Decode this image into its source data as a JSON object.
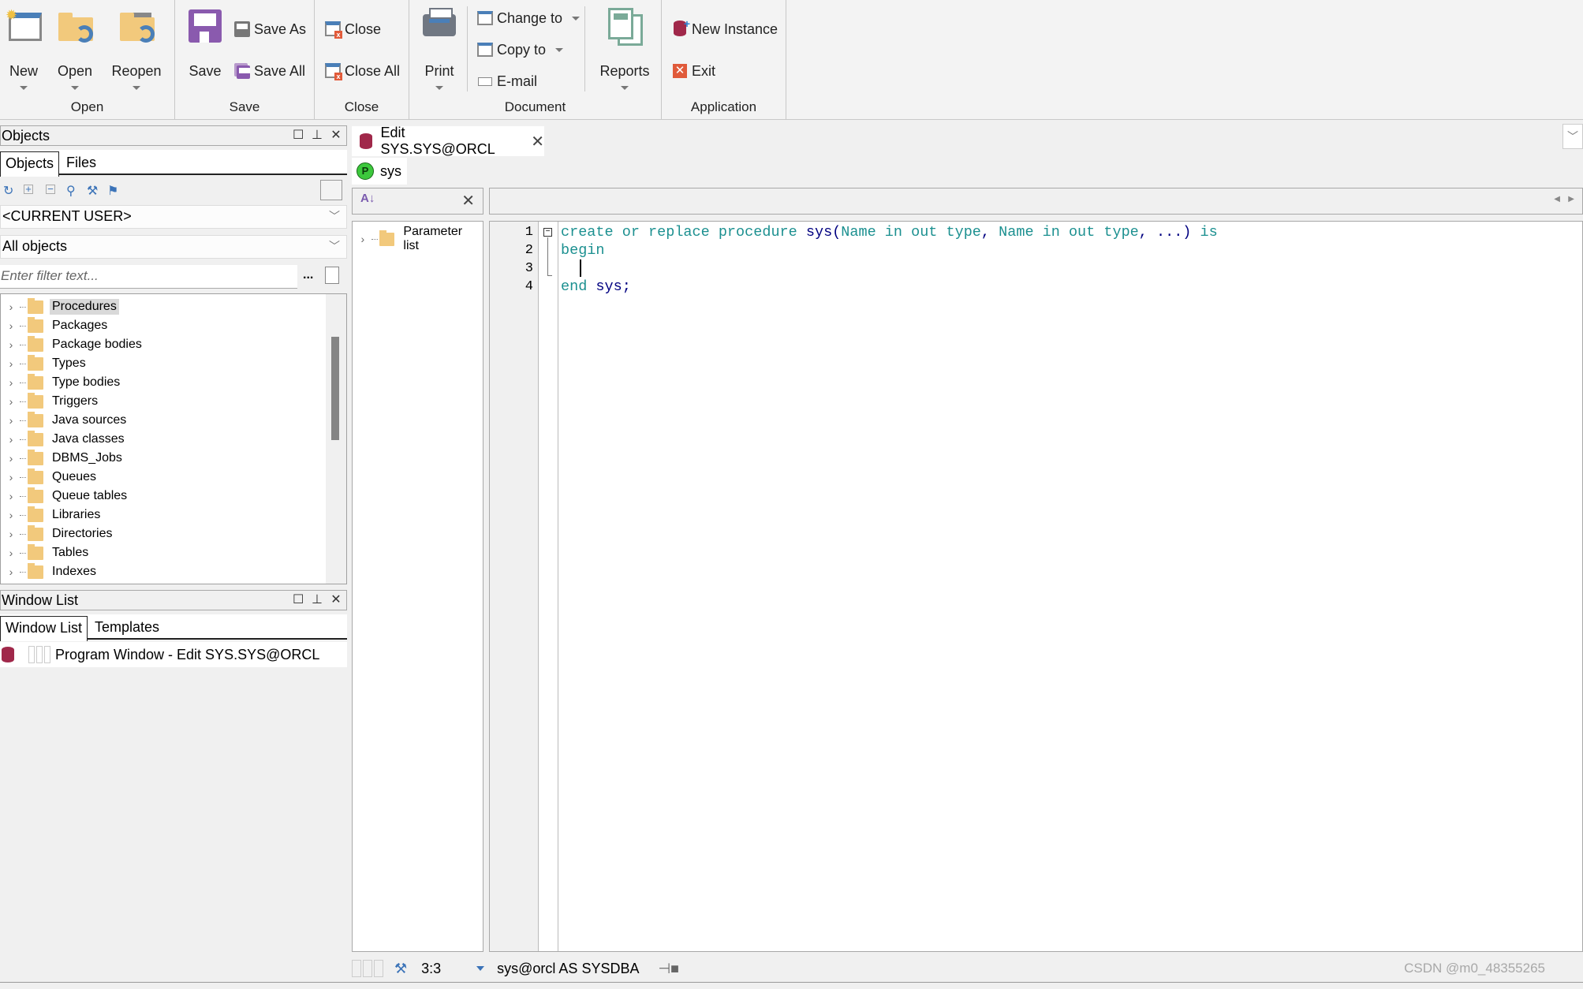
{
  "ribbon": {
    "groups": {
      "open": {
        "label": "Open",
        "new": "New",
        "open": "Open",
        "reopen": "Reopen"
      },
      "save": {
        "label": "Save",
        "save": "Save",
        "save_as": "Save As",
        "save_all": "Save All"
      },
      "close": {
        "label": "Close",
        "close": "Close",
        "close_all": "Close All"
      },
      "document": {
        "label": "Document",
        "print": "Print",
        "change_to": "Change to",
        "copy_to": "Copy to",
        "email": "E-mail",
        "reports": "Reports"
      },
      "application": {
        "label": "Application",
        "new_instance": "New Instance",
        "exit": "Exit"
      }
    }
  },
  "objects_panel": {
    "title": "Objects",
    "tabs": [
      "Objects",
      "Files"
    ],
    "toolbar_icons": [
      "refresh-icon",
      "expand-all-icon",
      "collapse-all-icon",
      "find-icon",
      "filter-icon",
      "folder-filter-icon"
    ],
    "user_combo": "<CURRENT USER>",
    "type_combo": "All objects",
    "filter_placeholder": "Enter filter text...",
    "filter_more": "...",
    "tree": [
      "Procedures",
      "Packages",
      "Package bodies",
      "Types",
      "Type bodies",
      "Triggers",
      "Java sources",
      "Java classes",
      "DBMS_Jobs",
      "Queues",
      "Queue tables",
      "Libraries",
      "Directories",
      "Tables",
      "Indexes"
    ],
    "selected": "Procedures"
  },
  "window_list_panel": {
    "title": "Window List",
    "tabs": [
      "Window List",
      "Templates"
    ],
    "items": [
      "Program Window - Edit SYS.SYS@ORCL"
    ]
  },
  "editor": {
    "doc_tab": "Edit SYS.SYS@ORCL",
    "sub_tab": "sys",
    "sub_tab_badge": "P",
    "param_tree": [
      "Parameter list"
    ],
    "line_numbers": [
      "1",
      "2",
      "3",
      "4"
    ],
    "code": [
      [
        [
          "kw",
          "create or replace procedure "
        ],
        [
          "id",
          "sys("
        ],
        [
          "kw",
          "Name in out type"
        ],
        [
          "id",
          ", "
        ],
        [
          "kw",
          "Name in out type"
        ],
        [
          "id",
          ", ...) "
        ],
        [
          "kw",
          "is"
        ]
      ],
      [
        [
          "kw",
          "begin"
        ]
      ],
      [],
      [
        [
          "kw",
          "end "
        ],
        [
          "id",
          "sys;"
        ]
      ]
    ],
    "colors": {
      "keyword": "#1c9090",
      "identifier": "#000080"
    }
  },
  "status": {
    "position": "3:3",
    "connection": "sys@orcl AS SYSDBA"
  },
  "watermark": "CSDN @m0_48355265"
}
